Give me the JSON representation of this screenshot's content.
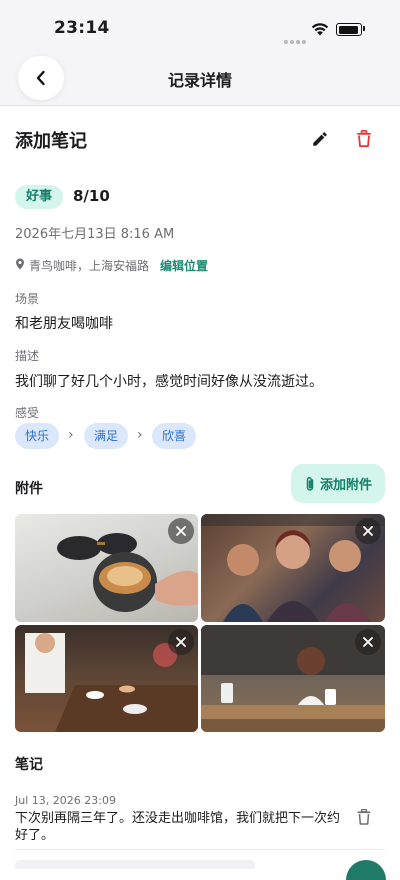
{
  "status_bar": {
    "time": "23:14"
  },
  "nav": {
    "title": "记录详情"
  },
  "record": {
    "title": "添加笔记",
    "type_badge": "好事",
    "score": "8/10",
    "date": "2026年七月13日 8:16 AM",
    "location": "青鸟咖啡，上海安福路",
    "edit_location": "编辑位置"
  },
  "scene": {
    "label": "场景",
    "value": "和老朋友喝咖啡"
  },
  "description": {
    "label": "描述",
    "value": "我们聊了好几个小时，感觉时间好像从没流逝过。"
  },
  "feelings": {
    "label": "感受",
    "items": [
      "快乐",
      "满足",
      "欣喜"
    ]
  },
  "attachments": {
    "title": "附件",
    "add_label": "添加附件"
  },
  "notes": {
    "title": "笔记",
    "items": [
      {
        "date": "Jul 13, 2026 23:09",
        "text": "下次别再隔三年了。还没走出咖啡馆，我们就把下一次约好了。"
      }
    ]
  },
  "colors": {
    "accent": "#15806a",
    "accent_bg": "#d3f5ec",
    "chip_text": "#2f6fc9",
    "chip_bg": "#dbe8fb",
    "danger": "#e53935"
  }
}
